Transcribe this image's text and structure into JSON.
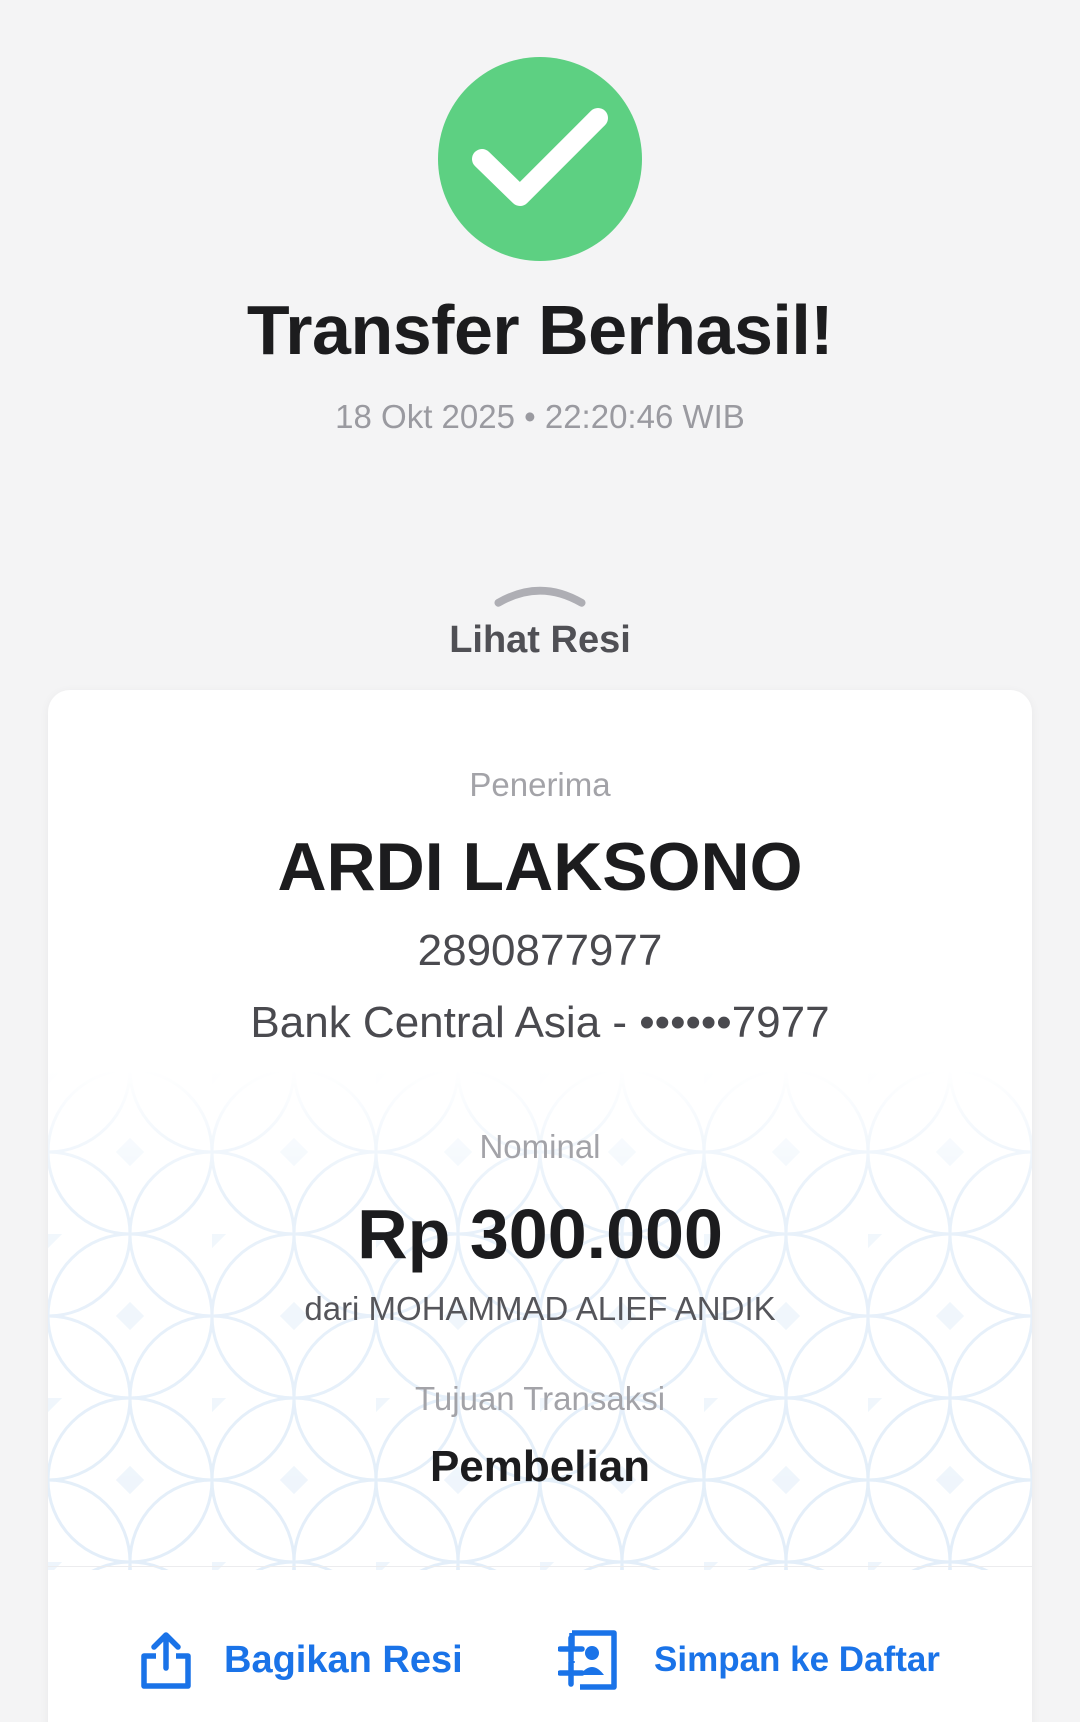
{
  "header": {
    "title": "Transfer Berhasil!",
    "timestamp": "18 Okt 2025 • 22:20:46 WIB"
  },
  "receipt_toggle": {
    "label": "Lihat Resi"
  },
  "receipt": {
    "recipient_label": "Penerima",
    "recipient_name": "ARDI LAKSONO",
    "recipient_account": "2890877977",
    "recipient_bank": "Bank Central Asia - ••••••7977",
    "amount_label": "Nominal",
    "amount": "Rp 300.000",
    "sender": "dari MOHAMMAD ALIEF ANDIK",
    "purpose_label": "Tujuan Transaksi",
    "purpose": "Pembelian"
  },
  "actions": {
    "share_label": "Bagikan Resi",
    "save_label": "Simpan ke Daftar"
  },
  "colors": {
    "success": "#5dd082",
    "accent": "#1a73e8",
    "background": "#f4f4f5"
  },
  "icons": [
    "check-icon",
    "chevron-up-icon",
    "share-icon",
    "add-contact-icon"
  ]
}
